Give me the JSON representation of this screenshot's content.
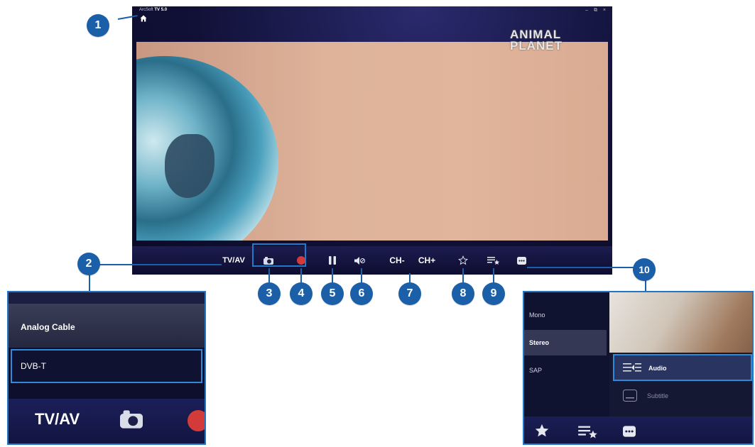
{
  "app": {
    "title_prefix": "ArcSoft",
    "title_bold": "TV 5.0",
    "window_controls": "– ⧉ ×"
  },
  "channel_logo": {
    "line1": "ANIMAL",
    "line2": "PLANET"
  },
  "controls": {
    "tvav": "TV/AV",
    "ch_minus": "CH-",
    "ch_plus": "CH+"
  },
  "callouts": [
    "1",
    "2",
    "3",
    "4",
    "5",
    "6",
    "7",
    "8",
    "9",
    "10"
  ],
  "source_panel": {
    "items": [
      "Analog Cable",
      "DVB-T"
    ],
    "selected": "DVB-T",
    "bar_label": "TV/AV"
  },
  "audio_panel": {
    "channels": [
      "Mono",
      "Stereo",
      "SAP"
    ],
    "selected_channel": "Stereo",
    "menu": [
      {
        "label": "Audio",
        "icon": "audio-track-icon"
      },
      {
        "label": "Subtitle",
        "icon": "subtitle-icon"
      }
    ],
    "selected_menu": "Audio"
  },
  "colors": {
    "callout": "#1a5fa8",
    "highlight_border": "#2f8bd8",
    "record": "#d33a3a"
  }
}
